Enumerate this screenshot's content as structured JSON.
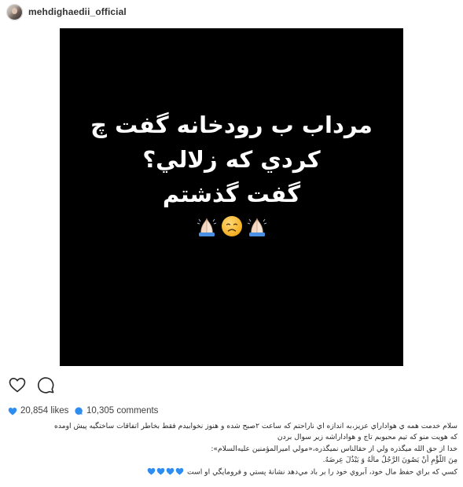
{
  "post": {
    "username": "mehdighaedii_official",
    "image_text": {
      "lines": [
        "مرداب ب رودخانه گفت چ",
        "كردي كه زلالي؟",
        "گفت گذشتم"
      ],
      "emojis": [
        "folded-hands",
        "disappointed-face",
        "folded-hands"
      ]
    },
    "likes": "20,854 likes",
    "comments": "10,305 comments",
    "caption": {
      "lines": [
        "سلام خدمت همه ي هواداراي عزيز،به اندازه اي ناراحتم كه ساعت ۲صبح شده و هنوز نخوابيدم فقط بخاطر اتفاقات ساختگيه پيش اومده",
        "كه هويت منو كه تيم محبوبم تاج و هواداراشه زير سوال بردن",
        "خدا از حق الله ميگذره ولي از حقالناس نميگذره،«مولي اميرالمؤمنين عليه‌السلام»:",
        "مِنَ اللُّؤْمِ أَنْ يَصُونَ الرَّجُلُ مالَهُ وَ يَبْذُلَ عِرضَهُ.",
        "كسي كه براي حفظ مال خود، آبروي خود را بر باد مي‌دهد نشانهٔ پستي و فرومايگي او است"
      ],
      "trailing_emoji": "blue-heart",
      "trailing_emoji_count": 4
    },
    "colors": {
      "heart_blue": "#2f8df2",
      "text_dark": "#262626",
      "photo_bg": "#000000"
    }
  }
}
